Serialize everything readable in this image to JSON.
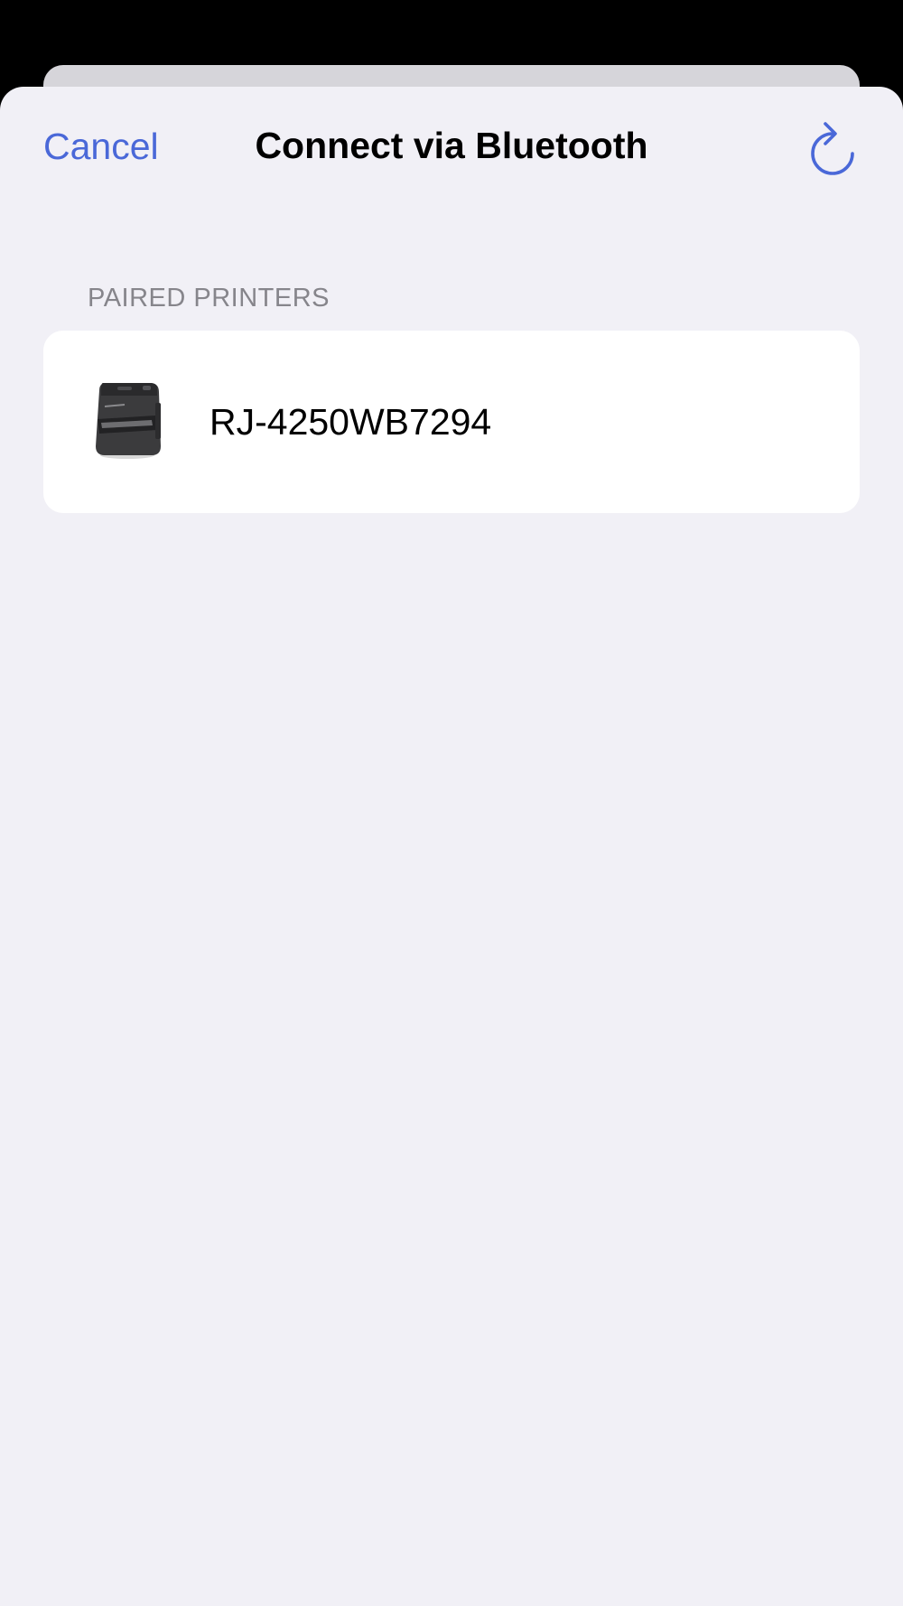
{
  "nav": {
    "cancel_label": "Cancel",
    "title": "Connect via Bluetooth",
    "refresh_icon": "refresh-icon"
  },
  "paired_section": {
    "header": "PAIRED PRINTERS",
    "printers": [
      {
        "name": "RJ-4250WB7294",
        "icon": "printer-icon"
      }
    ]
  },
  "colors": {
    "accent": "#4a68d8",
    "background": "#f1f0f6",
    "card": "#ffffff",
    "section_header": "#86858b"
  }
}
